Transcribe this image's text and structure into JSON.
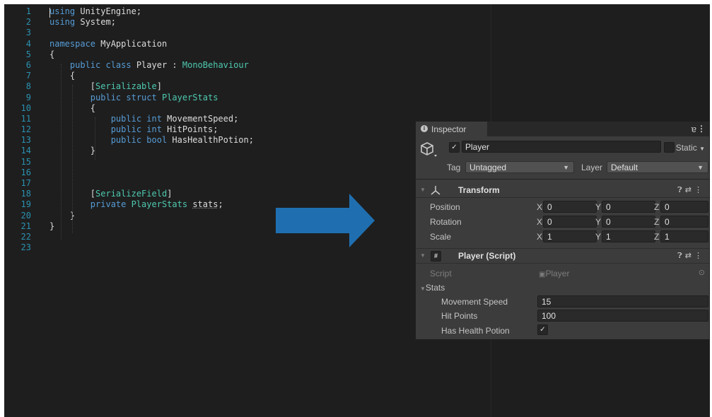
{
  "editor": {
    "lines": [
      {
        "n": "1",
        "segs": [
          {
            "t": "using",
            "c": "kw"
          },
          {
            "t": " UnityEngine;",
            "c": ""
          }
        ]
      },
      {
        "n": "2",
        "segs": [
          {
            "t": "using",
            "c": "kw"
          },
          {
            "t": " System;",
            "c": ""
          }
        ]
      },
      {
        "n": "3",
        "segs": []
      },
      {
        "n": "4",
        "segs": [
          {
            "t": "namespace",
            "c": "kw"
          },
          {
            "t": " MyApplication",
            "c": ""
          }
        ]
      },
      {
        "n": "5",
        "segs": [
          {
            "t": "{",
            "c": ""
          }
        ]
      },
      {
        "n": "6",
        "segs": [
          {
            "t": "    public class ",
            "c": "kw"
          },
          {
            "t": "Player",
            "c": ""
          },
          {
            "t": " : ",
            "c": ""
          },
          {
            "t": "MonoBehaviour",
            "c": "ty"
          }
        ]
      },
      {
        "n": "7",
        "segs": [
          {
            "t": "    {",
            "c": ""
          }
        ]
      },
      {
        "n": "8",
        "segs": [
          {
            "t": "        [",
            "c": ""
          },
          {
            "t": "Serializable",
            "c": "attr"
          },
          {
            "t": "]",
            "c": ""
          }
        ]
      },
      {
        "n": "9",
        "segs": [
          {
            "t": "        public struct ",
            "c": "kw"
          },
          {
            "t": "PlayerStats",
            "c": "ty"
          }
        ]
      },
      {
        "n": "10",
        "segs": [
          {
            "t": "        {",
            "c": ""
          }
        ]
      },
      {
        "n": "11",
        "segs": [
          {
            "t": "            public int ",
            "c": "kw"
          },
          {
            "t": "MovementSpeed;",
            "c": ""
          }
        ]
      },
      {
        "n": "12",
        "segs": [
          {
            "t": "            public int ",
            "c": "kw"
          },
          {
            "t": "HitPoints;",
            "c": ""
          }
        ]
      },
      {
        "n": "13",
        "segs": [
          {
            "t": "            public bool ",
            "c": "kw"
          },
          {
            "t": "HasHealthPotion;",
            "c": ""
          }
        ]
      },
      {
        "n": "14",
        "segs": [
          {
            "t": "        }",
            "c": ""
          }
        ]
      },
      {
        "n": "15",
        "segs": []
      },
      {
        "n": "16",
        "segs": []
      },
      {
        "n": "17",
        "segs": []
      },
      {
        "n": "18",
        "segs": [
          {
            "t": "        [",
            "c": ""
          },
          {
            "t": "SerializeField",
            "c": "attr"
          },
          {
            "t": "]",
            "c": ""
          }
        ]
      },
      {
        "n": "19",
        "segs": [
          {
            "t": "        private ",
            "c": "kw"
          },
          {
            "t": "PlayerStats",
            "c": "ty"
          },
          {
            "t": " ",
            "c": ""
          },
          {
            "t": "stats",
            "c": "squig"
          },
          {
            "t": ";",
            "c": ""
          }
        ]
      },
      {
        "n": "20",
        "segs": [
          {
            "t": "    }",
            "c": ""
          }
        ]
      },
      {
        "n": "21",
        "segs": [
          {
            "t": "}",
            "c": ""
          }
        ]
      },
      {
        "n": "22",
        "segs": []
      },
      {
        "n": "23",
        "segs": []
      }
    ]
  },
  "inspector": {
    "tab_label": "Inspector",
    "object_name": "Player",
    "static_label": "Static",
    "tag_label": "Tag",
    "tag_value": "Untagged",
    "layer_label": "Layer",
    "layer_value": "Default",
    "transform": {
      "title": "Transform",
      "position_label": "Position",
      "rotation_label": "Rotation",
      "scale_label": "Scale",
      "x_axis": "X",
      "y_axis": "Y",
      "z_axis": "Z",
      "position": [
        "0",
        "0",
        "0"
      ],
      "rotation": [
        "0",
        "0",
        "0"
      ],
      "scale": [
        "1",
        "1",
        "1"
      ]
    },
    "script_component": {
      "title": "Player (Script)",
      "script_label": "Script",
      "script_value": "Player",
      "stats_label": "Stats",
      "movement_speed_label": "Movement Speed",
      "movement_speed_value": "15",
      "hit_points_label": "Hit Points",
      "hit_points_value": "100",
      "has_health_potion_label": "Has Health Potion",
      "has_health_potion_checked": true
    }
  },
  "colors": {
    "arrow": "#1f6fb0",
    "editor_bg": "#1e1e1e",
    "inspector_bg": "#3c3c3c"
  }
}
